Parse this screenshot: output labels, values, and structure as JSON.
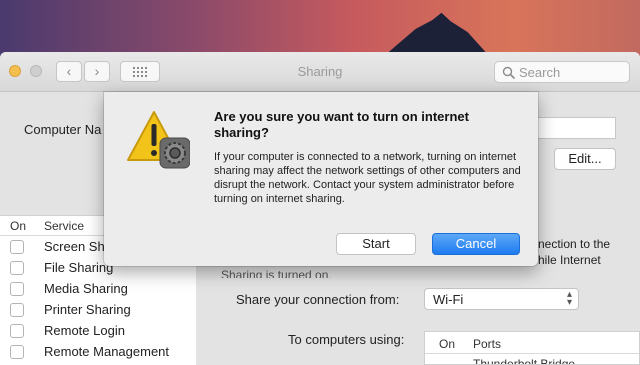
{
  "window": {
    "title": "Sharing"
  },
  "toolbar": {
    "search_placeholder": "Search",
    "back_label": "‹",
    "forward_label": "›"
  },
  "computer_name": {
    "label": "Computer Na",
    "edit_label": "Edit..."
  },
  "services": {
    "header_on": "On",
    "header_service": "Service",
    "items": [
      {
        "label": "Screen Sh"
      },
      {
        "label": "File Sharing"
      },
      {
        "label": "Media Sharing"
      },
      {
        "label": "Printer Sharing"
      },
      {
        "label": "Remote Login"
      },
      {
        "label": "Remote Management"
      }
    ]
  },
  "detail": {
    "text_line1": "nection to the",
    "text_line2": "hile Internet",
    "text_line3": "Sharing is turned on.",
    "share_from_label": "Share your connection from:",
    "share_from_value": "Wi-Fi",
    "to_computers_label": "To computers using:",
    "ports_header_on": "On",
    "ports_header_ports": "Ports",
    "ports_first_row": "Thunderbolt Bridge"
  },
  "dialog": {
    "title": "Are you sure you want to turn on internet sharing?",
    "body": "If your computer is connected to a network, turning on internet sharing may affect the network settings of other computers and disrupt the network. Contact your system administrator before turning on internet sharing.",
    "start_label": "Start",
    "cancel_label": "Cancel"
  },
  "colors": {
    "accent": "#1e7bf0",
    "warning": "#f2c318",
    "traffic_minimize": "#f5bf4f"
  },
  "icons": {
    "dialog_icon": "warning-triangle-with-gear-icon",
    "search": "search-icon"
  }
}
